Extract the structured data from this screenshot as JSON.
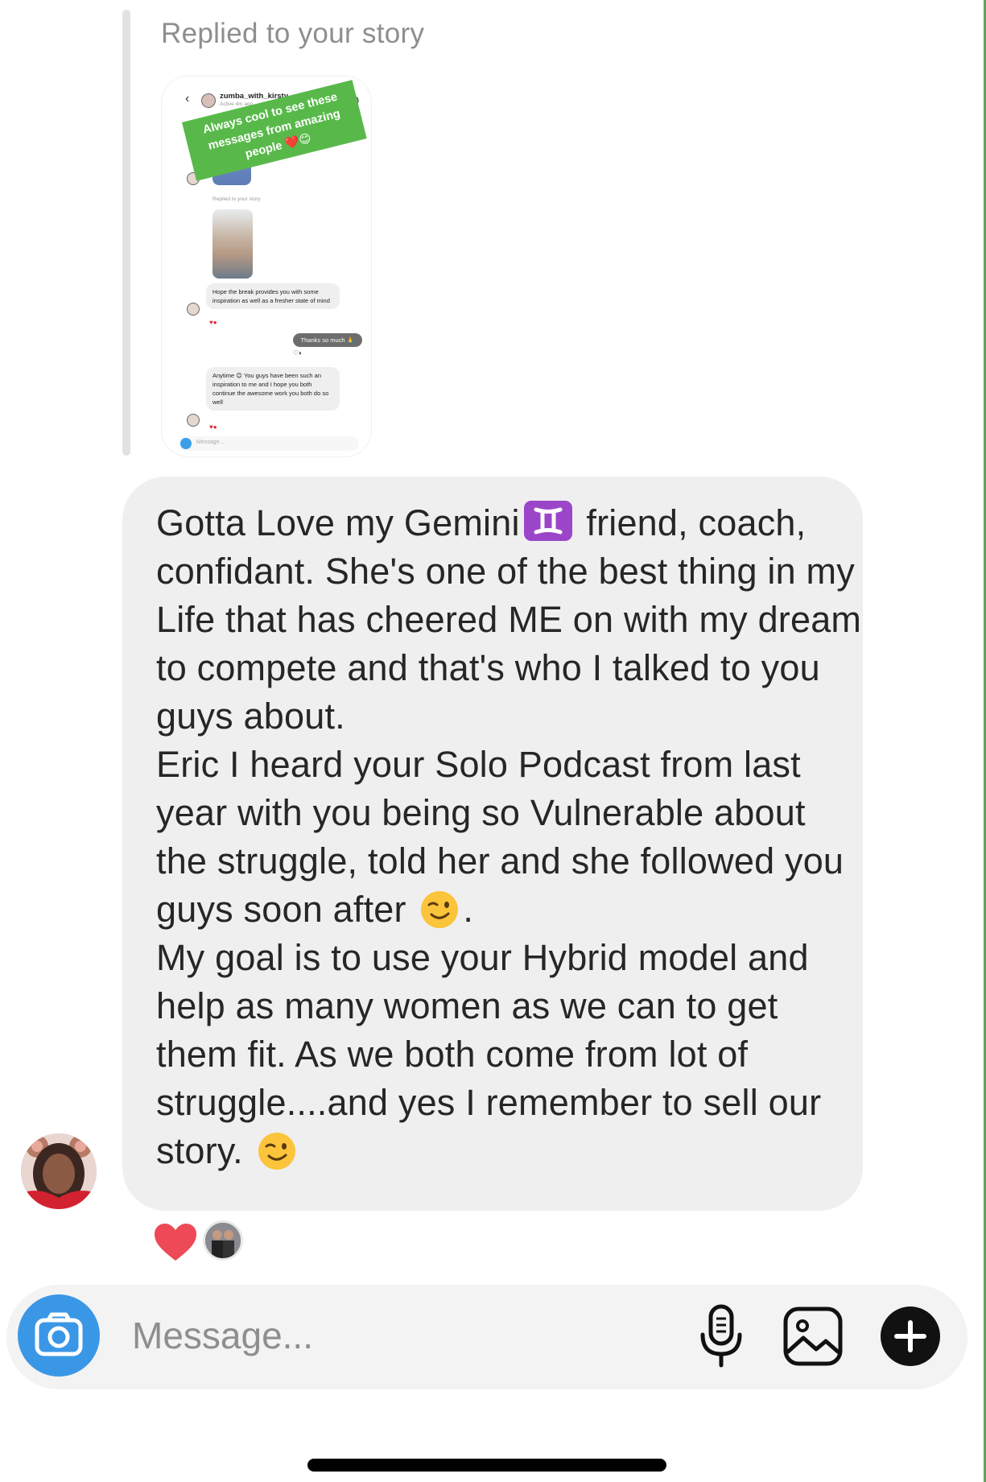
{
  "reply_label": "Replied to your story",
  "story": {
    "username": "zumba_with_kirsty",
    "active_status": "Active 4m ago",
    "sticker_text": "Always cool to see these messages from amazing people ❤️😊",
    "replied_label": "Replied to your story",
    "message_1": "Hope the break provides you with some inspiration as well as a fresher state of mind",
    "message_2": "Thanks so much 🙏",
    "message_3": "Anytime 😊 You guys have been such an inspiration to me and I hope you both continue the awesome work you both do so well",
    "input_placeholder": "Message..."
  },
  "message": {
    "para1_a": "Gotta Love my Gemini",
    "para1_b": " friend, coach, confidant. She's one of the best thing in my Life that has cheered ME on with my dream to compete and that's who I talked to you guys about.",
    "para2_a": "Eric I heard your Solo Podcast from last year with you being so Vulnerable about the struggle, told her and she followed you guys soon after",
    "para2_b": ".",
    "para3": "My goal is to use your Hybrid model and help as many women as we can to get them fit. As we both come from lot of struggle....and yes I remember to sell our story."
  },
  "composer": {
    "placeholder": "Message..."
  },
  "icons": [
    "camera-icon",
    "microphone-icon",
    "gallery-icon",
    "plus-icon",
    "heart-icon"
  ],
  "colors": {
    "bubble": "#efefef",
    "camera_button": "#3a97e6",
    "sticker_green": "#58b94a",
    "heart": "#ed4956"
  }
}
